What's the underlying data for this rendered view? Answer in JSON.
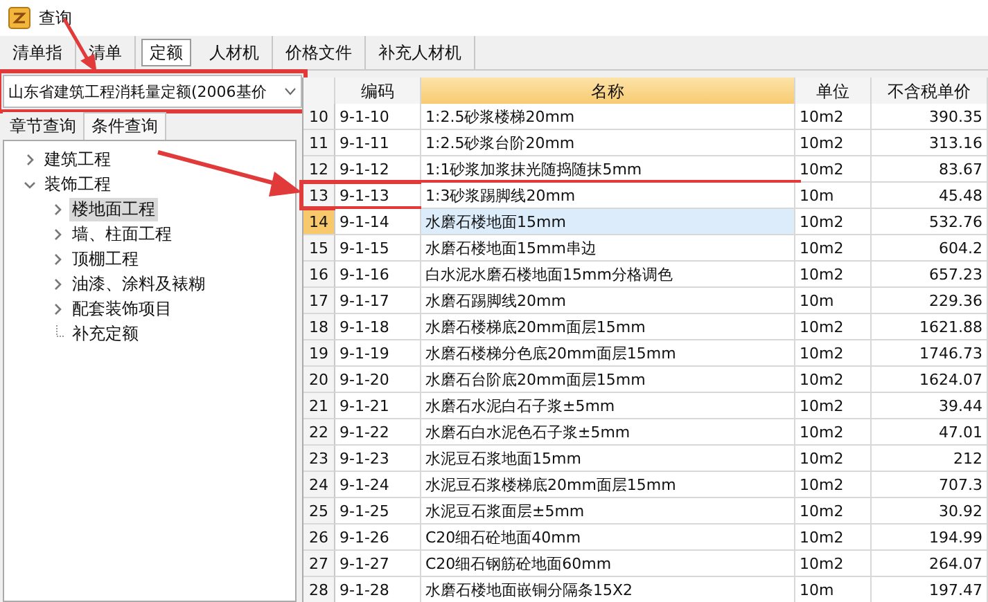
{
  "window": {
    "title": "查询"
  },
  "tabs": [
    {
      "label": "清单指",
      "selected": false
    },
    {
      "label": "清单",
      "selected": false
    },
    {
      "label": "定额",
      "selected": true
    },
    {
      "label": "人材机",
      "selected": false
    },
    {
      "label": "价格文件",
      "selected": false
    },
    {
      "label": "补充人材机",
      "selected": false
    }
  ],
  "library_select": {
    "value": "山东省建筑工程消耗量定额(2006基价",
    "highlighted": true
  },
  "query_tabs": [
    {
      "label": "章节查询",
      "selected": true
    },
    {
      "label": "条件查询",
      "selected": false
    }
  ],
  "tree": [
    {
      "label": "建筑工程",
      "expanded": false,
      "selected": false
    },
    {
      "label": "装饰工程",
      "expanded": true,
      "selected": false,
      "children": [
        {
          "label": "楼地面工程",
          "selected": true,
          "kind": "folder"
        },
        {
          "label": "墙、柱面工程",
          "selected": false,
          "kind": "folder"
        },
        {
          "label": "顶棚工程",
          "selected": false,
          "kind": "folder"
        },
        {
          "label": "油漆、涂料及裱糊",
          "selected": false,
          "kind": "folder"
        },
        {
          "label": "配套装饰项目",
          "selected": false,
          "kind": "folder"
        },
        {
          "label": "补充定额",
          "selected": false,
          "kind": "leaf"
        }
      ]
    }
  ],
  "table": {
    "columns": [
      {
        "label": "编码",
        "selected": false
      },
      {
        "label": "名称",
        "selected": true
      },
      {
        "label": "单位",
        "selected": false
      },
      {
        "label": "不含税单价",
        "selected": false
      }
    ],
    "rows": [
      {
        "no": "10",
        "code": "9-1-10",
        "name": "1:2.5砂浆楼梯20mm",
        "unit": "10m2",
        "price": "390.35",
        "selected": false,
        "highlighted": false
      },
      {
        "no": "11",
        "code": "9-1-11",
        "name": "1:2.5砂浆台阶20mm",
        "unit": "10m2",
        "price": "313.16",
        "selected": false,
        "highlighted": false
      },
      {
        "no": "12",
        "code": "9-1-12",
        "name": "1:1砂浆加浆抹光随捣随抹5mm",
        "unit": "10m2",
        "price": "83.67",
        "selected": false,
        "highlighted": false
      },
      {
        "no": "13",
        "code": "9-1-13",
        "name": "1:3砂浆踢脚线20mm",
        "unit": "10m",
        "price": "45.48",
        "selected": false,
        "highlighted": true
      },
      {
        "no": "14",
        "code": "9-1-14",
        "name": "水磨石楼地面15mm",
        "unit": "10m2",
        "price": "532.76",
        "selected": true,
        "highlighted": false
      },
      {
        "no": "15",
        "code": "9-1-15",
        "name": "水磨石楼地面15mm串边",
        "unit": "10m2",
        "price": "604.2",
        "selected": false,
        "highlighted": false
      },
      {
        "no": "16",
        "code": "9-1-16",
        "name": "白水泥水磨石楼地面15mm分格调色",
        "unit": "10m2",
        "price": "657.23",
        "selected": false,
        "highlighted": false
      },
      {
        "no": "17",
        "code": "9-1-17",
        "name": "水磨石踢脚线20mm",
        "unit": "10m",
        "price": "229.36",
        "selected": false,
        "highlighted": false
      },
      {
        "no": "18",
        "code": "9-1-18",
        "name": "水磨石楼梯底20mm面层15mm",
        "unit": "10m2",
        "price": "1621.88",
        "selected": false,
        "highlighted": false
      },
      {
        "no": "19",
        "code": "9-1-19",
        "name": "水磨石楼梯分色底20mm面层15mm",
        "unit": "10m2",
        "price": "1746.73",
        "selected": false,
        "highlighted": false
      },
      {
        "no": "20",
        "code": "9-1-20",
        "name": "水磨石台阶底20mm面层15mm",
        "unit": "10m2",
        "price": "1624.07",
        "selected": false,
        "highlighted": false
      },
      {
        "no": "21",
        "code": "9-1-21",
        "name": "水磨石水泥白石子浆±5mm",
        "unit": "10m2",
        "price": "39.44",
        "selected": false,
        "highlighted": false
      },
      {
        "no": "22",
        "code": "9-1-22",
        "name": "水磨石白水泥色石子浆±5mm",
        "unit": "10m2",
        "price": "47.01",
        "selected": false,
        "highlighted": false
      },
      {
        "no": "23",
        "code": "9-1-23",
        "name": "水泥豆石浆地面15mm",
        "unit": "10m2",
        "price": "212",
        "selected": false,
        "highlighted": false
      },
      {
        "no": "24",
        "code": "9-1-24",
        "name": "水泥豆石浆楼梯底20mm面层15mm",
        "unit": "10m2",
        "price": "707.3",
        "selected": false,
        "highlighted": false
      },
      {
        "no": "25",
        "code": "9-1-25",
        "name": "水泥豆石浆面层±5mm",
        "unit": "10m2",
        "price": "30.92",
        "selected": false,
        "highlighted": false
      },
      {
        "no": "26",
        "code": "9-1-26",
        "name": "C20细石砼地面40mm",
        "unit": "10m2",
        "price": "194.99",
        "selected": false,
        "highlighted": false
      },
      {
        "no": "27",
        "code": "9-1-27",
        "name": "C20细石钢筋砼地面60mm",
        "unit": "10m2",
        "price": "264.07",
        "selected": false,
        "highlighted": false
      },
      {
        "no": "28",
        "code": "9-1-28",
        "name": "水磨石楼地面嵌铜分隔条15X2",
        "unit": "10m",
        "price": "197.47",
        "selected": false,
        "highlighted": false
      }
    ]
  }
}
